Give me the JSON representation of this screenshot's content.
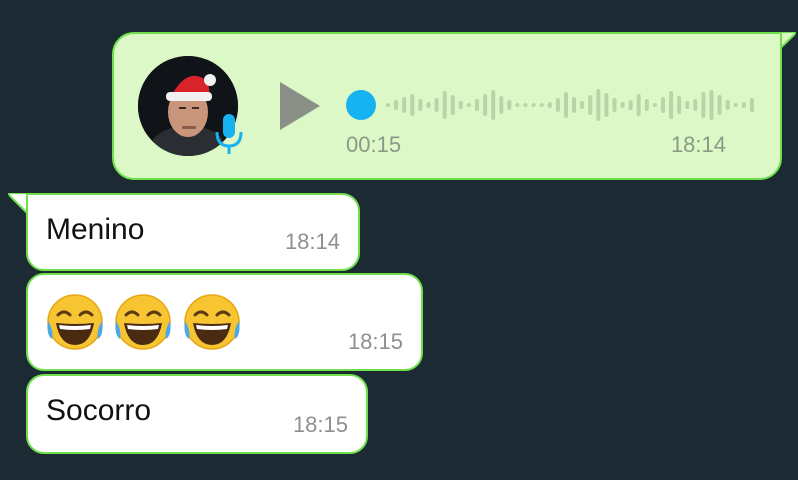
{
  "voice_message": {
    "duration": "00:15",
    "time": "18:14",
    "progress": 0,
    "avatar_icon": "santa-hat-avatar",
    "mic_icon": "microphone-icon",
    "play_icon": "play-icon"
  },
  "messages": [
    {
      "text": "Menino",
      "time": "18:14"
    },
    {
      "emoji": [
        "face-with-tears-of-joy",
        "face-with-tears-of-joy",
        "face-with-tears-of-joy"
      ],
      "time": "18:15"
    },
    {
      "text": "Socorro",
      "time": "18:15"
    }
  ],
  "colors": {
    "background": "#1c2a33",
    "outgoing_bubble": "#dcf8c6",
    "bubble_border": "#6fe04a",
    "accent_blue": "#17b2f2",
    "play_grey": "#8a9088"
  }
}
